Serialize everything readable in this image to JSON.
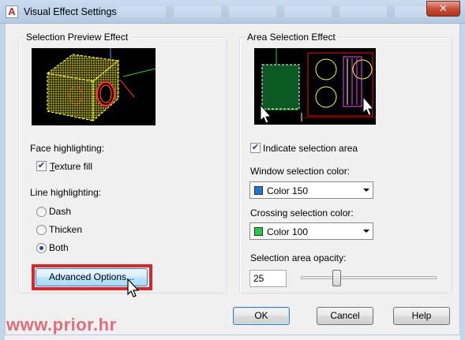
{
  "window": {
    "title": "Visual Effect Settings",
    "close_glyph": "✕",
    "app_icon_glyph": "A"
  },
  "selection_preview": {
    "legend": "Selection Preview Effect",
    "face_highlighting_label": "Face highlighting:",
    "texture_fill": {
      "label": "Texture fill",
      "checked": true
    },
    "line_highlighting_label": "Line highlighting:",
    "options": [
      {
        "label": "Dash",
        "selected": false
      },
      {
        "label": "Thicken",
        "selected": false
      },
      {
        "label": "Both",
        "selected": true
      }
    ],
    "advanced_button": "Advanced Options..."
  },
  "area_selection": {
    "legend": "Area Selection Effect",
    "indicate_area": {
      "label": "Indicate selection area",
      "checked": true
    },
    "window_color_label": "Window selection color:",
    "window_color": {
      "value": "Color 150",
      "swatch": "#1f74d6"
    },
    "crossing_color_label": "Crossing selection color:",
    "crossing_color": {
      "value": "Color 100",
      "swatch": "#22cc44"
    },
    "opacity_label": "Selection area opacity:",
    "opacity_value": "25",
    "opacity_fraction": 0.25
  },
  "footer": {
    "ok": "OK",
    "cancel": "Cancel",
    "help": "Help"
  },
  "watermark": "www.prior.hr",
  "colors": {
    "highlight_red": "#d8262a",
    "preview_yellow": "#e8e200",
    "preview_green": "#0b5a24"
  }
}
